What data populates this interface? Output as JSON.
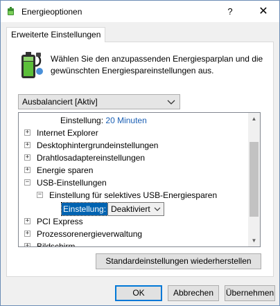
{
  "window": {
    "title": "Energieoptionen",
    "help_label": "?",
    "close_label": "✕"
  },
  "tab": {
    "label": "Erweiterte Einstellungen"
  },
  "intro_text": "Wählen Sie den anzupassenden Energiesparplan und die gewünschten Energiespareinstellungen aus.",
  "plan_select": {
    "value": "Ausbalanciert [Aktiv]"
  },
  "tree": {
    "setting_label": "Einstellung:",
    "setting_value": "20 Minuten",
    "items": [
      "Internet Explorer",
      "Desktophintergrundeinstellungen",
      "Drahtlosadaptereinstellungen",
      "Energie sparen",
      "USB-Einstellungen",
      "Einstellung für selektives USB-Energiesparen",
      "PCI Express",
      "Prozessorenergieverwaltung",
      "Bildschirm"
    ],
    "usb_setting_label": "Einstellung:",
    "usb_setting_value": "Deaktiviert",
    "collapsed_marker": "+",
    "expanded_marker": "−"
  },
  "buttons": {
    "restore_label": "Standardeinstellungen wiederherstellen",
    "ok_label": "OK",
    "cancel_label": "Abbrechen",
    "apply_label": "Übernehmen"
  },
  "colors": {
    "accent": "#0078d7",
    "selection": "#0063b1",
    "link_blue": "#1a5fb4"
  }
}
